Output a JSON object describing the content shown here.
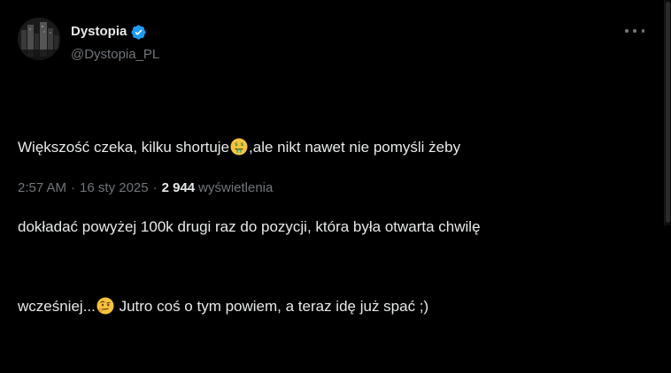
{
  "author": {
    "display_name": "Dystopia",
    "handle": "@Dystopia_PL",
    "avatar_icon": "dark-city-avatar",
    "verified_icon": "verified-badge-icon",
    "verified_color": "#1d9bf0"
  },
  "tweet": {
    "line1_a": "Większość czeka, kilku shortuje",
    "line1_b": ",ale nikt nawet nie pomyśli żeby",
    "line2": "dokładać powyżej 100k drugi raz do pozycji, która była otwarta chwilę",
    "line3_a": "wcześniej...",
    "line3_b": " Jutro coś o tym powiem, a teraz idę już spać ;)",
    "emoji_1": "money-mouth-face-emoji",
    "emoji_2": "face-with-raised-eyebrow-emoji"
  },
  "meta": {
    "time": "2:57 AM",
    "separator": "·",
    "date": "16 sty 2025",
    "views_count": "2 944",
    "views_label": "wyświetlenia"
  },
  "more_icon": "more-options-icon",
  "colors": {
    "background": "#000000",
    "text_primary": "#e7e9ea",
    "text_secondary": "#71767b",
    "accent": "#1d9bf0"
  }
}
